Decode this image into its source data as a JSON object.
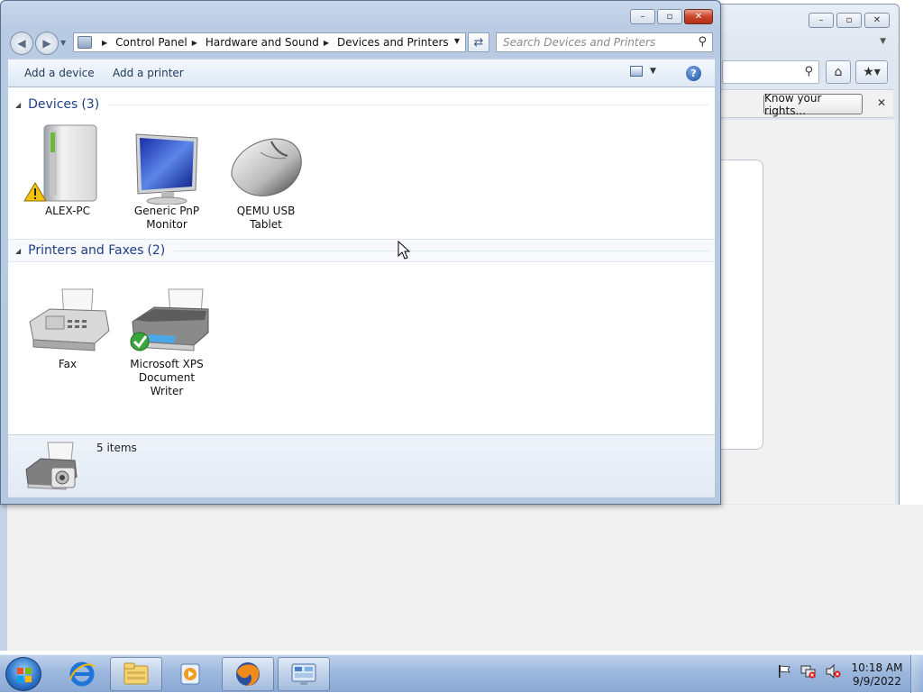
{
  "window": {
    "breadcrumb": [
      "Control Panel",
      "Hardware and Sound",
      "Devices and Printers"
    ],
    "search_placeholder": "Search Devices and Printers"
  },
  "toolbar": {
    "add_device": "Add a device",
    "add_printer": "Add a printer"
  },
  "groups": {
    "devices": {
      "title": "Devices",
      "count": "(3)",
      "items": [
        {
          "line1": "ALEX-PC",
          "line2": "",
          "icon": "computer-icon",
          "warning": true
        },
        {
          "line1": "Generic PnP",
          "line2": "Monitor",
          "icon": "monitor-icon",
          "warning": false
        },
        {
          "line1": "QEMU USB",
          "line2": "Tablet",
          "icon": "mouse-icon",
          "warning": false
        }
      ]
    },
    "printers": {
      "title": "Printers and Faxes",
      "count": "(2)",
      "items": [
        {
          "line1": "Fax",
          "line2": "",
          "icon": "fax-icon",
          "default": false
        },
        {
          "line1": "Microsoft XPS",
          "line2": "Document Writer",
          "icon": "printer-icon",
          "default": true
        }
      ]
    }
  },
  "status": {
    "items_text": "5 items"
  },
  "background_browser": {
    "notification_button": "Know your rights..."
  },
  "taskbar": {
    "time": "10:18 AM",
    "date": "9/9/2022"
  },
  "colors": {
    "group_header_text": "#1e3e87",
    "toolbar_text": "#1e395b",
    "taskbar": "#9db8de"
  }
}
